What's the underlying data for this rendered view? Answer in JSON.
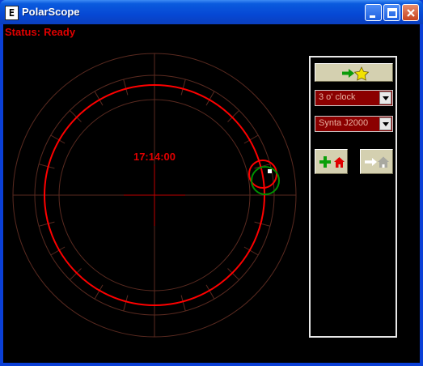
{
  "window": {
    "title": "PolarScope"
  },
  "status": {
    "label": "Status:",
    "value": "Ready"
  },
  "scope": {
    "time": "17:14:00"
  },
  "panel": {
    "goto_star_icon": "arrow-star-icon",
    "clock_position": {
      "selected": "3 o' clock"
    },
    "telescope_model": {
      "selected": "Synta J2000"
    },
    "set_home_icon": "plus-home-icon",
    "go_home_icon": "arrow-home-icon"
  },
  "colors": {
    "ring": "#ff0000",
    "grid": "#5a2a20",
    "status": "#e00000",
    "crosshair": "#c00000",
    "target_green": "#009000"
  }
}
